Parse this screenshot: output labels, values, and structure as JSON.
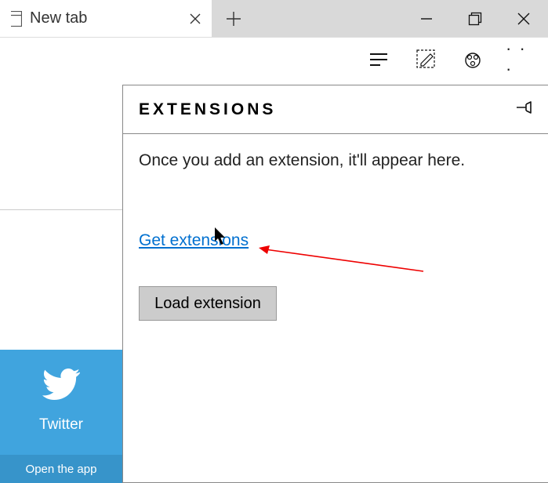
{
  "titlebar": {
    "tab_title": "New tab"
  },
  "panel": {
    "title": "Extensions",
    "description": "Once you add an extension, it'll appear here.",
    "get_link": "Get extensions",
    "load_button": "Load extension"
  },
  "tile": {
    "name": "Twitter",
    "footer": "Open the app"
  }
}
